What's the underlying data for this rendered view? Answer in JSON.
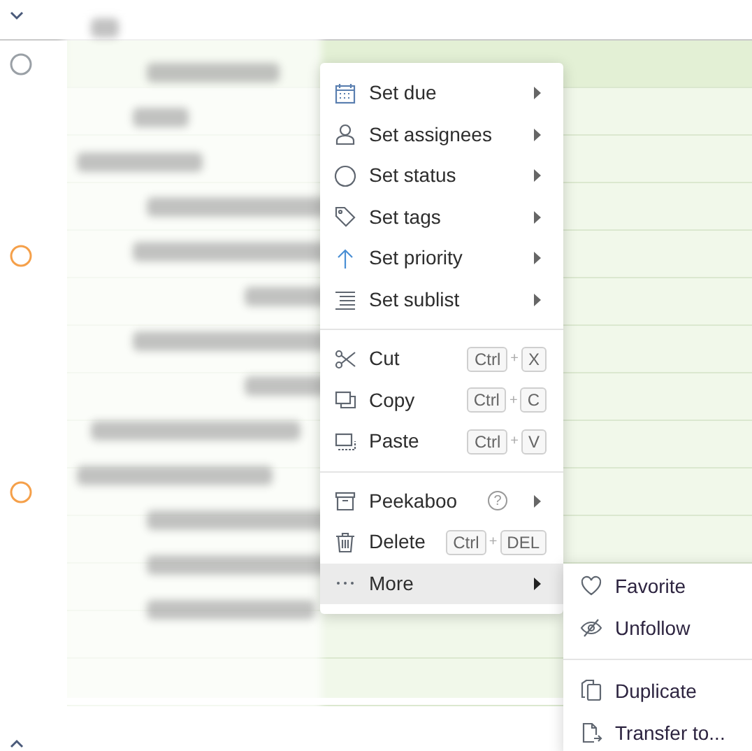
{
  "menu": {
    "sections": [
      [
        {
          "label": "Set due",
          "submenu": true,
          "selected": false
        },
        {
          "label": "Set assignees",
          "submenu": true,
          "selected": false
        },
        {
          "label": "Set status",
          "submenu": true,
          "selected": false
        },
        {
          "label": "Set tags",
          "submenu": true,
          "selected": false
        },
        {
          "label": "Set priority",
          "submenu": true,
          "selected": false
        },
        {
          "label": "Set sublist",
          "submenu": true,
          "selected": false
        }
      ],
      [
        {
          "label": "Cut",
          "shortcut": [
            "Ctrl",
            "+",
            "X"
          ],
          "submenu": false,
          "selected": false
        },
        {
          "label": "Copy",
          "shortcut": [
            "Ctrl",
            "+",
            "C"
          ],
          "submenu": false,
          "selected": false
        },
        {
          "label": "Paste",
          "shortcut": [
            "Ctrl",
            "+",
            "V"
          ],
          "submenu": false,
          "selected": false
        }
      ],
      [
        {
          "label": "Peekaboo",
          "help": "?",
          "submenu": true,
          "selected": false
        },
        {
          "label": "Delete",
          "shortcut": [
            "Ctrl",
            "+",
            "DEL"
          ],
          "submenu": false,
          "selected": false
        },
        {
          "label": "More",
          "submenu": true,
          "selected": true
        }
      ]
    ]
  },
  "submenu": {
    "sections": [
      [
        {
          "label": "Favorite"
        },
        {
          "label": "Unfollow"
        }
      ],
      [
        {
          "label": "Duplicate"
        },
        {
          "label": "Transfer to..."
        }
      ]
    ]
  }
}
